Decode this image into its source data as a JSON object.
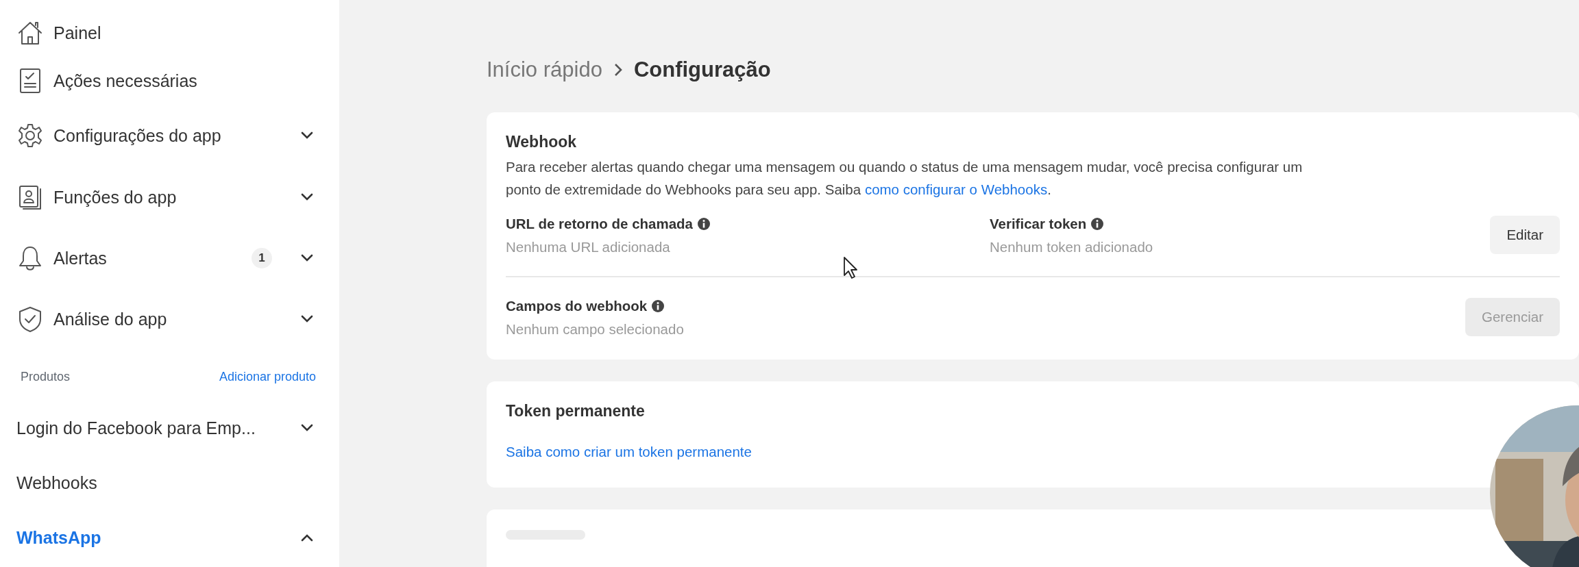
{
  "sidebar": {
    "items": [
      {
        "label": "Painel"
      },
      {
        "label": "Ações necessárias"
      },
      {
        "label": "Configurações do app",
        "expanded": false
      },
      {
        "label": "Funções do app",
        "expanded": false
      },
      {
        "label": "Alertas",
        "expanded": false,
        "badge": "1"
      },
      {
        "label": "Análise do app",
        "expanded": false
      }
    ],
    "products_header": {
      "label": "Produtos",
      "action": "Adicionar produto"
    },
    "products": [
      {
        "label": "Login do Facebook para Emp...",
        "expanded": false,
        "selected": false
      },
      {
        "label": "Webhooks",
        "selected": false
      },
      {
        "label": "WhatsApp",
        "expanded": true,
        "selected": true
      }
    ]
  },
  "breadcrumb": [
    "Início rápido",
    "Configuração"
  ],
  "webhook_card": {
    "title": "Webhook",
    "description": "Para receber alertas quando chegar uma mensagem ou quando o status de uma mensagem mudar, você precisa configurar um ponto de extremidade do Webhooks para seu app. Saiba ",
    "link": "como configurar o Webhooks",
    "after_link": ".",
    "fields": [
      {
        "label": "URL de retorno de chamada",
        "value": "Nenhuma URL adicionada"
      },
      {
        "label": "Verificar token",
        "value": "Nenhum token adicionado"
      }
    ],
    "edit_button": {
      "label": "Editar",
      "disabled": false
    },
    "webhook_fields": {
      "label": "Campos do webhook",
      "value": "Nenhum campo selecionado"
    },
    "manage_button": {
      "label": "Gerenciar",
      "disabled": true
    }
  },
  "token_card": {
    "title": "Token permanente",
    "link": "Saiba como criar um token permanente"
  },
  "webcam": {
    "kind": "picture"
  }
}
